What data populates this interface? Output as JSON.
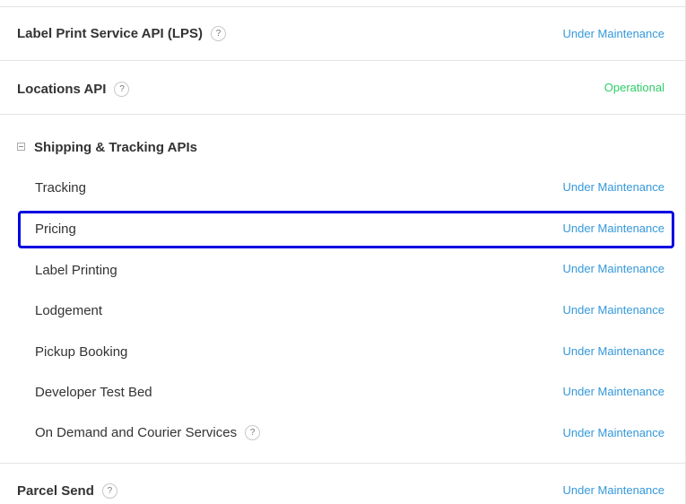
{
  "components": {
    "lps": {
      "name": "Label Print Service API (LPS)",
      "help": "?",
      "status": "Under Maintenance"
    },
    "locations": {
      "name": "Locations API",
      "help": "?",
      "status": "Operational"
    },
    "shipping_group": {
      "name": "Shipping & Tracking APIs",
      "items": [
        {
          "name": "Tracking",
          "status": "Under Maintenance"
        },
        {
          "name": "Pricing",
          "status": "Under Maintenance"
        },
        {
          "name": "Label Printing",
          "status": "Under Maintenance"
        },
        {
          "name": "Lodgement",
          "status": "Under Maintenance"
        },
        {
          "name": "Pickup Booking",
          "status": "Under Maintenance"
        },
        {
          "name": "Developer Test Bed",
          "status": "Under Maintenance"
        },
        {
          "name": "On Demand and Courier Services",
          "help": "?",
          "status": "Under Maintenance"
        }
      ]
    },
    "parcel_send": {
      "name": "Parcel Send",
      "help": "?",
      "status": "Under Maintenance"
    }
  },
  "colors": {
    "maintenance": "#3498db",
    "operational": "#2fcc66",
    "highlight": "#0000e0"
  }
}
